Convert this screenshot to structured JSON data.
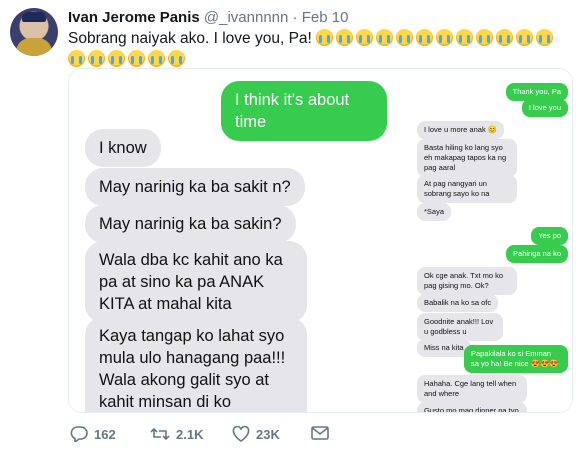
{
  "tweet": {
    "name": "Ivan Jerome Panis",
    "handle": "@_ivannnnn",
    "separator": "·",
    "date": "Feb 10",
    "text": "Sobrang naiyak ako. I love you, Pa!",
    "emoji_count": 18
  },
  "left_messages": [
    {
      "side": "out",
      "text": "I think it's about time"
    },
    {
      "side": "in",
      "text": "I know"
    },
    {
      "side": "in",
      "text": "May narinig ka ba sakit n?"
    },
    {
      "side": "in",
      "text": "May narinig ka ba sakin?"
    },
    {
      "side": "in",
      "text": "Wala dba kc kahit ano ka pa at sino ka pa ANAK KITA at mahal kita"
    },
    {
      "side": "in",
      "text": "Kaya tangap ko lahat syo mula ulo hanagang paa!!! Wala akong galit syo at kahit minsan di ko ikinahiya ang anak ko"
    }
  ],
  "right_messages": [
    {
      "side": "out",
      "text": "Thank you, Pa"
    },
    {
      "side": "out",
      "text": "I love you"
    },
    {
      "side": "in",
      "text": "I love u more anak 😊"
    },
    {
      "side": "in",
      "text": "Basta hiling ko lang syo eh makapag tapos ka ng pag aaral"
    },
    {
      "side": "in",
      "text": "At pag nangyari un sobrang sayo ko na"
    },
    {
      "side": "in",
      "text": "*Saya"
    },
    {
      "side": "out",
      "text": "Yes po"
    },
    {
      "side": "out",
      "text": "Pahinga na ko"
    },
    {
      "side": "in",
      "text": "Ok cge anak. Txt mo ko pag gising mo. Ok?"
    },
    {
      "side": "in",
      "text": "Babalik na ko sa ofc"
    },
    {
      "side": "in",
      "text": "Goodnite anak!!! Lov u godbless u"
    },
    {
      "side": "in",
      "text": "Miss na kita"
    },
    {
      "side": "out",
      "text": "Papakilala ko si Emman sa yo ha! Be nice 😍😍😍"
    },
    {
      "side": "in",
      "text": "Hahaha. Cge lang tell when and where"
    },
    {
      "side": "in",
      "text": "Gusto mo mag dinner pa tyo"
    }
  ],
  "actions": {
    "replies": "162",
    "retweets": "2.1K",
    "likes": "23K"
  },
  "colors": {
    "imessage_green": "#37cc4e",
    "received_gray": "#e5e5ea",
    "meta_gray": "#657786"
  }
}
